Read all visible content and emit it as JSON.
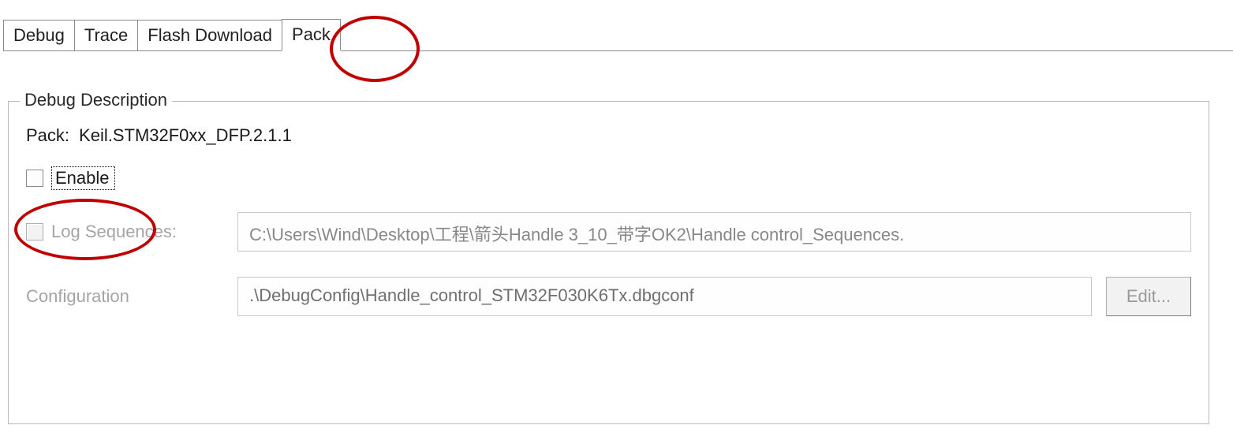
{
  "tabs": {
    "items": [
      {
        "label": "Debug"
      },
      {
        "label": "Trace"
      },
      {
        "label": "Flash Download"
      },
      {
        "label": "Pack"
      }
    ],
    "active_index": 3
  },
  "groupbox": {
    "title": "Debug Description",
    "pack_label": "Pack:",
    "pack_value": "Keil.STM32F0xx_DFP.2.1.1",
    "enable_label": "Enable",
    "enable_checked": false,
    "log_sequences": {
      "label": "Log Sequences:",
      "checked": false,
      "value": "C:\\Users\\Wind\\Desktop\\工程\\箭头Handle 3_10_带字OK2\\Handle control_Sequences."
    },
    "configuration": {
      "label": "Configuration",
      "value": ".\\DebugConfig\\Handle_control_STM32F030K6Tx.dbgconf",
      "edit_label": "Edit..."
    }
  }
}
